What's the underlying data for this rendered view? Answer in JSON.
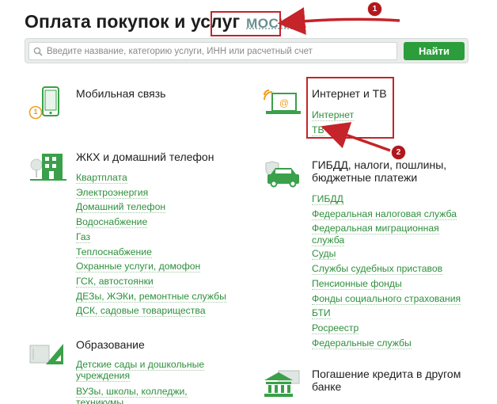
{
  "header": {
    "title": "Оплата покупок и услуг",
    "city": "МОСКВА"
  },
  "search": {
    "placeholder": "Введите название, категорию услуги, ИНН или расчетный счет",
    "button_label": "Найти"
  },
  "categories": {
    "mobile": {
      "title": "Мобильная связь"
    },
    "internet_tv": {
      "title": "Интернет и ТВ",
      "items": [
        "Интернет",
        "ТВ"
      ]
    },
    "housing": {
      "title": "ЖКХ и домашний телефон",
      "items": [
        "Квартплата",
        "Электроэнергия",
        "Домашний телефон",
        "Водоснабжение",
        "Газ",
        "Теплоснабжение",
        "Охранные услуги, домофон",
        "ГСК, автостоянки",
        "ДЕЗы, ЖЭКи, ремонтные службы",
        "ДСК, садовые товарищества"
      ]
    },
    "gibdd": {
      "title_line1": "ГИБДД, налоги, пошлины,",
      "title_line2": "бюджетные платежи",
      "items": [
        "ГИБДД",
        "Федеральная налоговая служба",
        "Федеральная миграционная",
        "служба",
        "Суды",
        "Службы судебных приставов",
        "Пенсионные фонды",
        "Фонды социального страхования",
        "БТИ",
        "Росреестр",
        "Федеральные службы"
      ]
    },
    "education": {
      "title": "Образование",
      "items": [
        "Детские сады и дошкольные",
        "учреждения",
        "ВУЗы, школы, колледжи,",
        "техникумы"
      ]
    },
    "loan": {
      "title_line1": "Погашение кредита в другом",
      "title_line2": "банке"
    }
  },
  "annotations": {
    "badge1": "1",
    "badge2": "2",
    "mobile_badge": "1"
  },
  "colors": {
    "accent_green": "#2b9d3b",
    "annotation_red": "#c4242a",
    "link_green": "#2e8f3c"
  }
}
